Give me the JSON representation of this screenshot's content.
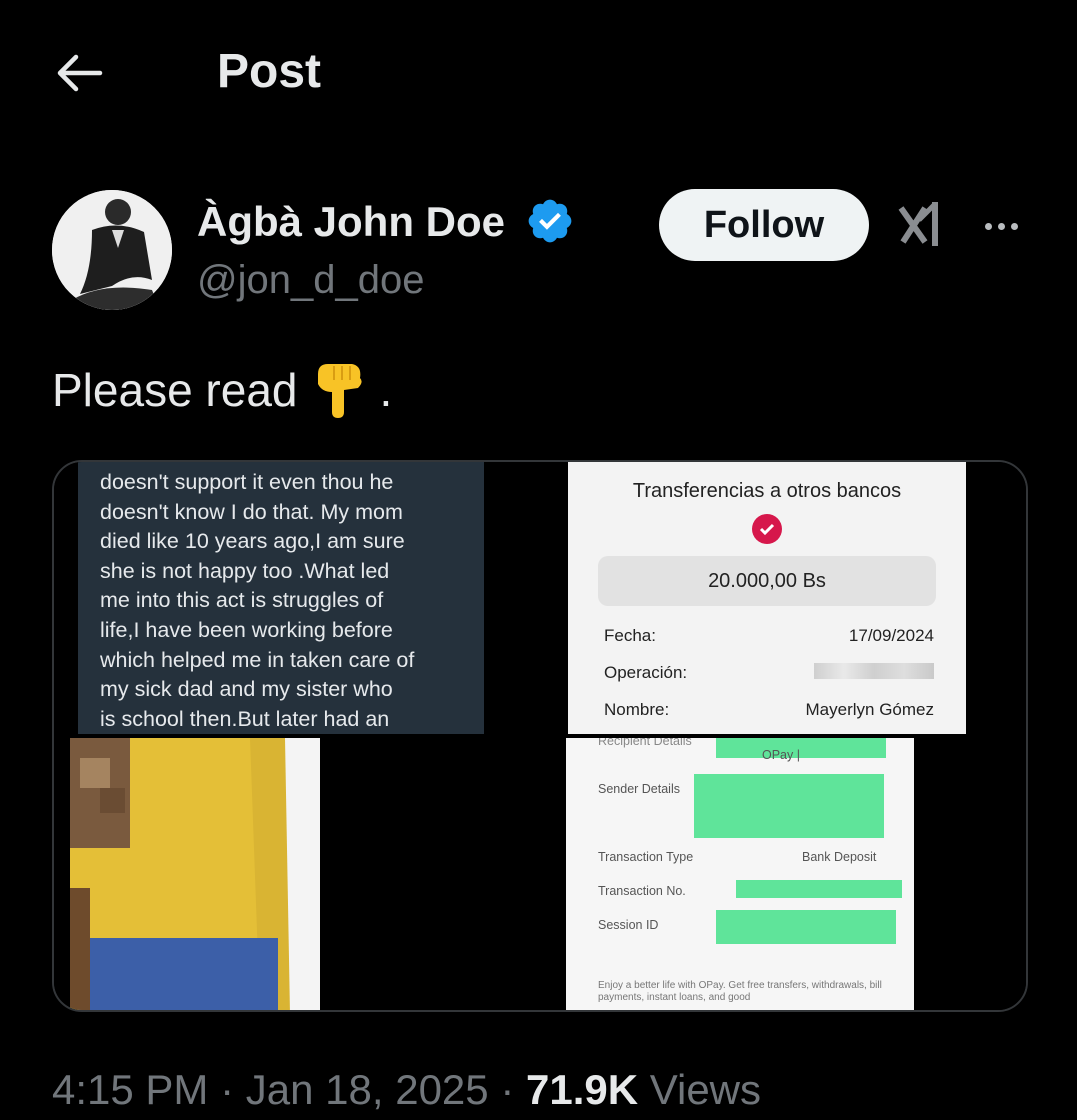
{
  "header": {
    "title": "Post"
  },
  "author": {
    "name": "Àgbà John Doe",
    "handle": "@jon_d_doe",
    "follow_label": "Follow"
  },
  "post": {
    "text": "Please read",
    "trailing": "."
  },
  "media": {
    "chat_lines": [
      "doesn't support it even thou he",
      "doesn't know I do that. My mom",
      "died like 10 years ago,I am sure",
      "she is not happy too .What led",
      "me into this act is struggles of",
      "life,I have been working before",
      "which helped me in taken care of",
      "my sick dad and my sister who",
      "is school then.But later had an"
    ],
    "receipt_bank": {
      "title": "Transferencias a otros bancos",
      "amount": "20.000,00 Bs",
      "fecha_label": "Fecha:",
      "fecha_value": "17/09/2024",
      "operacion_label": "Operación:",
      "nombre_label": "Nombre:",
      "nombre_value": "Mayerlyn Gómez"
    },
    "receipt_opay": {
      "recipient_label": "Recipient Details",
      "recipient_value": "OPay |",
      "sender_label": "Sender Details",
      "type_label": "Transaction Type",
      "type_value": "Bank Deposit",
      "txn_label": "Transaction No.",
      "session_label": "Session ID",
      "footer": "Enjoy a better life with OPay. Get free transfers, withdrawals, bill payments, instant loans, and good"
    }
  },
  "meta": {
    "time": "4:15 PM",
    "separator": "·",
    "date": "Jan 18, 2025",
    "views_count": "71.9K",
    "views_label": "Views"
  },
  "colors": {
    "background": "#000000",
    "text_primary": "#e7e9ea",
    "text_secondary": "#71767b",
    "verified": "#1d9bf0",
    "follow_bg": "#eff3f4"
  }
}
